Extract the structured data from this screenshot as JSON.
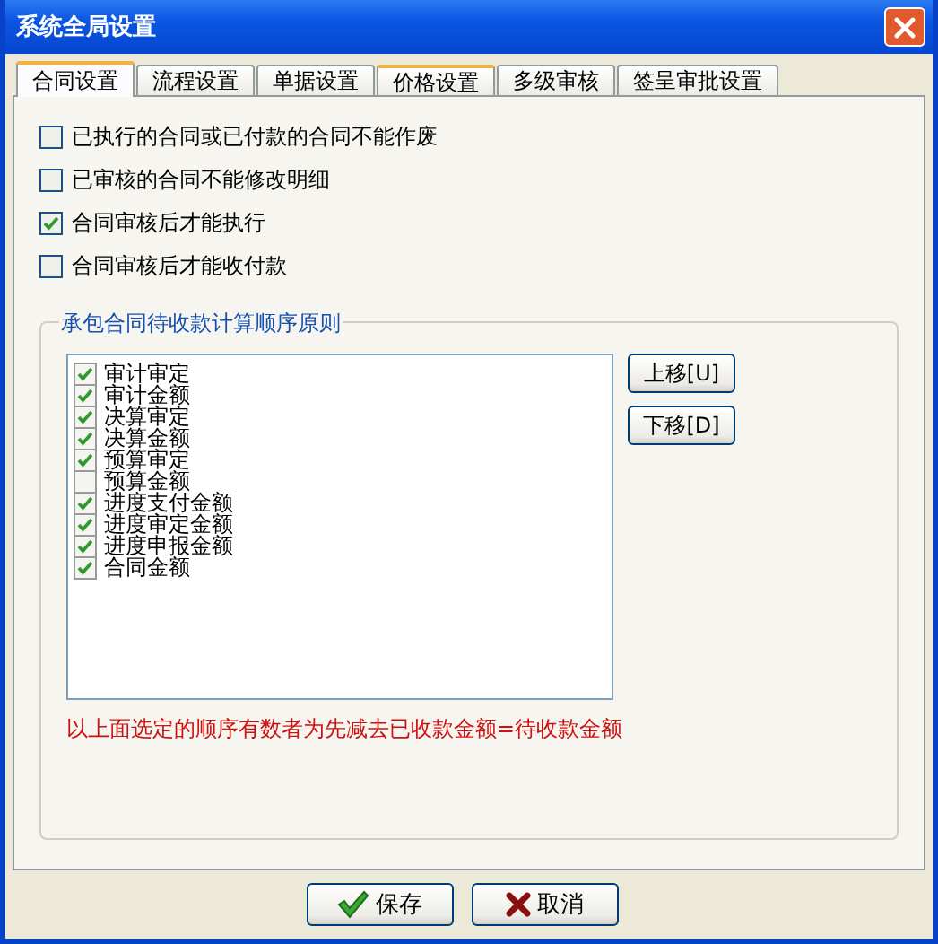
{
  "window": {
    "title": "系统全局设置"
  },
  "tabs": [
    {
      "label": "合同设置",
      "selected": true,
      "hovered": false
    },
    {
      "label": "流程设置",
      "selected": false,
      "hovered": false
    },
    {
      "label": "单据设置",
      "selected": false,
      "hovered": false
    },
    {
      "label": "价格设置",
      "selected": false,
      "hovered": true
    },
    {
      "label": "多级审核",
      "selected": false,
      "hovered": false
    },
    {
      "label": "签呈审批设置",
      "selected": false,
      "hovered": false
    }
  ],
  "options": [
    {
      "label": "已执行的合同或已付款的合同不能作废",
      "checked": false
    },
    {
      "label": "已审核的合同不能修改明细",
      "checked": false
    },
    {
      "label": "合同审核后才能执行",
      "checked": true
    },
    {
      "label": "合同审核后才能收付款",
      "checked": false
    }
  ],
  "group": {
    "title": "承包合同待收款计算顺序原则",
    "items": [
      {
        "label": "审计审定",
        "checked": true
      },
      {
        "label": "审计金额",
        "checked": true
      },
      {
        "label": "决算审定",
        "checked": true
      },
      {
        "label": "决算金额",
        "checked": true
      },
      {
        "label": "预算审定",
        "checked": true
      },
      {
        "label": "预算金额",
        "checked": false
      },
      {
        "label": "进度支付金额",
        "checked": true
      },
      {
        "label": "进度审定金额",
        "checked": true
      },
      {
        "label": "进度申报金额",
        "checked": true
      },
      {
        "label": "合同金额",
        "checked": true
      }
    ],
    "move_buttons": [
      "上移[U]",
      "下移[D]"
    ],
    "note": "以上面选定的顺序有数者为先减去已收款金额=待收款金额"
  },
  "buttons": [
    {
      "label": "保存",
      "kind": "save"
    },
    {
      "label": "取消",
      "kind": "cancel"
    }
  ]
}
